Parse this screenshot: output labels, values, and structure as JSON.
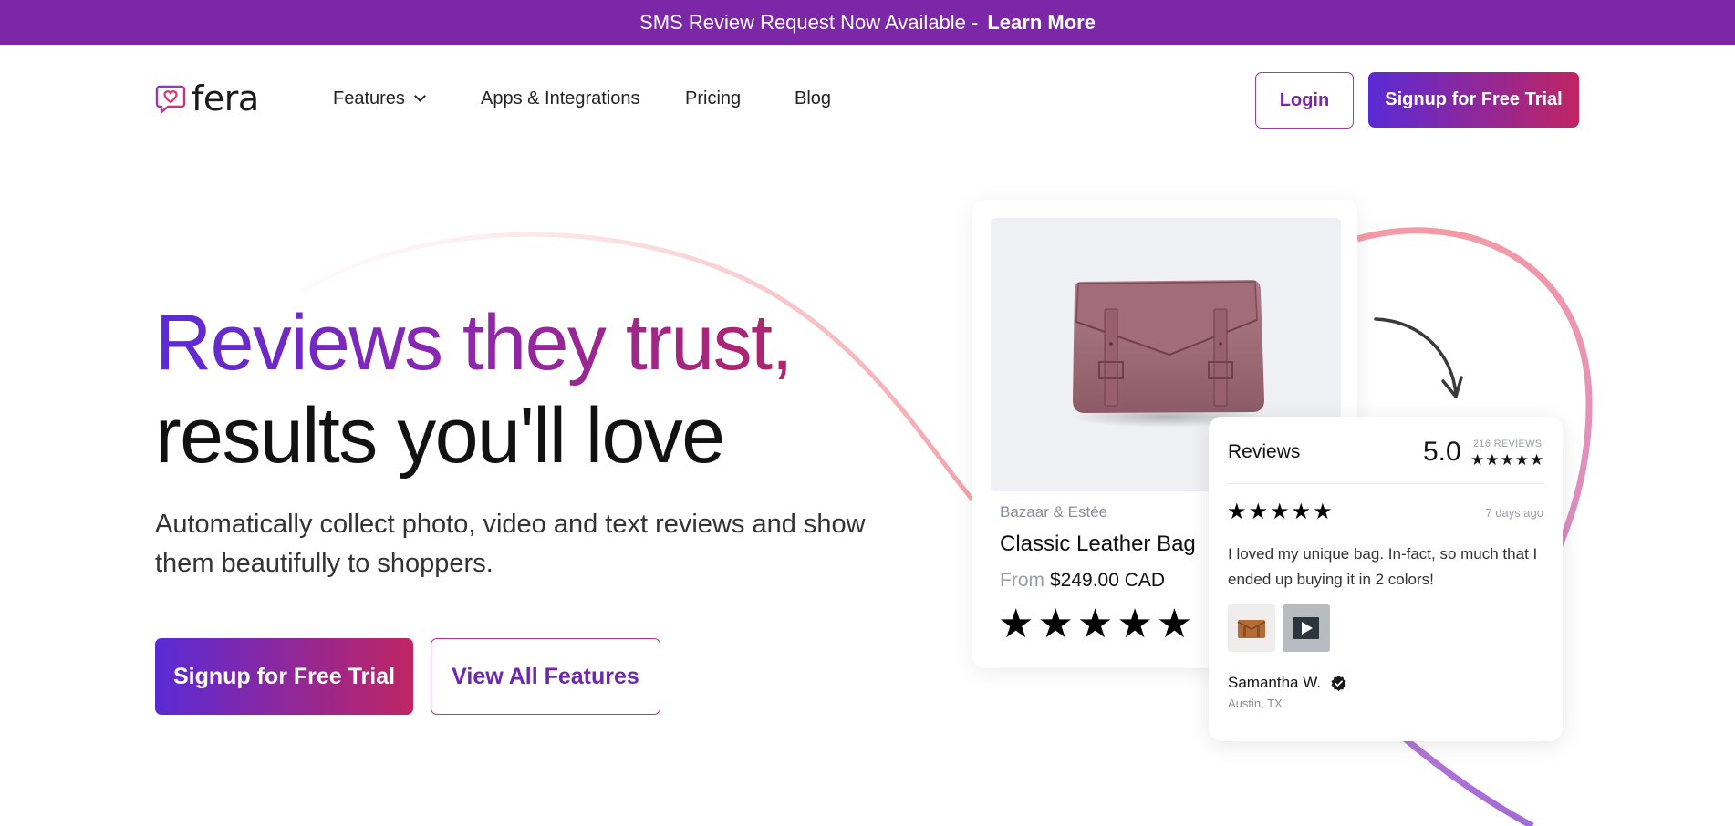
{
  "announcement": {
    "text": "SMS Review Request Now Available -",
    "link": "Learn More"
  },
  "nav": {
    "logo_text": "fera",
    "items": [
      {
        "label": "Features"
      },
      {
        "label": "Apps & Integrations"
      },
      {
        "label": "Pricing"
      },
      {
        "label": "Blog"
      }
    ],
    "login": "Login",
    "signup": "Signup for Free Trial"
  },
  "hero": {
    "title_line1": "Reviews they trust,",
    "title_line2": "results you'll love",
    "subtitle": "Automatically collect photo, video and text reviews and show them beautifully to shoppers.",
    "cta_primary": "Signup for Free Trial",
    "cta_secondary": "View All Features"
  },
  "product_card": {
    "brand": "Bazaar & Estée",
    "name": "Classic Leather Bag",
    "price_prefix": "From",
    "price": "$249.00 CAD",
    "rating_stars": "★★★★★"
  },
  "review_card": {
    "title": "Reviews",
    "score": "5.0",
    "count": "216 REVIEWS",
    "total_stars": "★★★★★",
    "review": {
      "stars": "★★★★★",
      "date": "7 days ago",
      "text": "I loved my unique bag. In-fact, so much that I ended up buying it in 2 colors!",
      "author": "Samantha W.",
      "location": "Austin, TX"
    }
  },
  "colors": {
    "brand_purple": "#7b27a8",
    "gradient_start": "#5a2ad6",
    "gradient_end": "#c02562"
  },
  "icons": {
    "logo": "heart-speech-bubble-icon",
    "dropdown": "chevron-down-icon",
    "verified": "verified-check-icon",
    "video": "play-icon"
  }
}
